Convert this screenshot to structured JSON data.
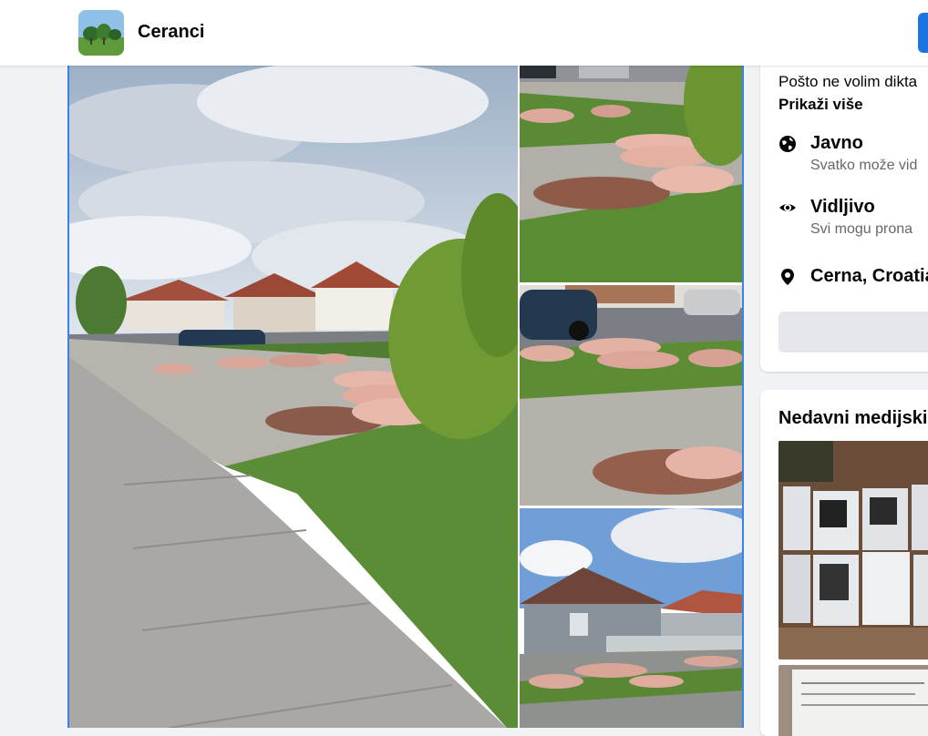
{
  "header": {
    "group_name": "Ceranci",
    "avatar_icon": "group-avatar-tree-icon"
  },
  "post": {
    "photos": [
      {
        "name": "photo-main-street-pigs"
      },
      {
        "name": "photo-pigs-on-lawn-1"
      },
      {
        "name": "photo-pigs-on-lawn-2"
      },
      {
        "name": "photo-houses-pigs"
      }
    ]
  },
  "about": {
    "description": "Pošto ne volim dikta",
    "show_more": "Prikaži više",
    "items": [
      {
        "icon": "globe-icon",
        "title": "Javno",
        "subtitle": "Svatko može vid"
      },
      {
        "icon": "eye-icon",
        "title": "Vidljivo",
        "subtitle": "Svi mogu prona"
      },
      {
        "icon": "location-pin-icon",
        "title": "Cerna, Croatia",
        "subtitle": ""
      }
    ]
  },
  "recent_media": {
    "title": "Nedavni medijski"
  },
  "colors": {
    "accent": "#1b74e4",
    "selection_border": "#3b82e6",
    "background": "#f0f2f5"
  }
}
